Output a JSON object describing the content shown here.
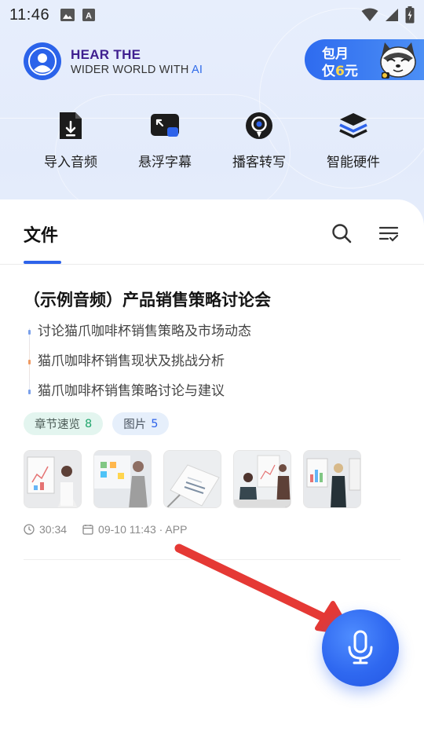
{
  "status_bar": {
    "time": "11:46",
    "notif_icons": [
      "image-icon",
      "a-icon"
    ],
    "right_icons": [
      "wifi-icon",
      "signal-icon",
      "battery-icon"
    ]
  },
  "brand": {
    "line1_part1": "HEAR THE",
    "line2_part1": "WIDER WORLD WITH ",
    "line2_part2": "AI"
  },
  "promo": {
    "line1": "包月",
    "line2_prefix": "仅",
    "line2_highlight": "6",
    "line2_suffix": "元"
  },
  "quick_actions": [
    {
      "label": "导入音频",
      "icon": "import-audio-icon"
    },
    {
      "label": "悬浮字幕",
      "icon": "floating-subtitle-icon"
    },
    {
      "label": "播客转写",
      "icon": "podcast-transcribe-icon"
    },
    {
      "label": "智能硬件",
      "icon": "smart-hardware-icon"
    }
  ],
  "tabs": {
    "files": "文件"
  },
  "file_card": {
    "title": "（示例音频）产品销售策略讨论会",
    "outline": [
      "讨论猫爪咖啡杯销售策略及市场动态",
      "猫爪咖啡杯销售现状及挑战分析",
      "猫爪咖啡杯销售策略讨论与建议"
    ],
    "tags": [
      {
        "label": "章节速览",
        "count": "8"
      },
      {
        "label": "图片",
        "count": "5"
      }
    ],
    "duration": "30:34",
    "datetime": "09-10  11:43 · APP"
  },
  "colors": {
    "accent": "#2e63ea",
    "annotation_arrow": "#e53935"
  }
}
